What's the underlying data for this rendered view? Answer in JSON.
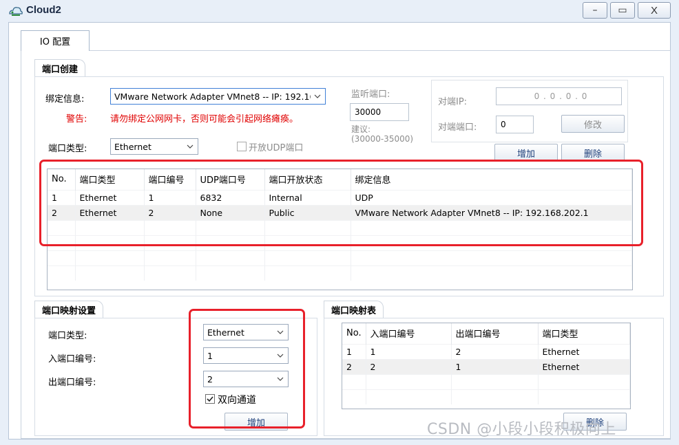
{
  "window": {
    "title": "Cloud2",
    "controls": {
      "minimize": "–",
      "maximize": "▭",
      "close": "X"
    }
  },
  "tabs": [
    {
      "label": "IO 配置",
      "active": true
    }
  ],
  "port_creation": {
    "group_title": "端口创建",
    "bind_info_label": "绑定信息:",
    "bind_info_value": "VMware Network Adapter VMnet8 -- IP: 192.16",
    "warning_label": "警告:",
    "warning_text": "请勿绑定公网网卡，否则可能会引起网络瘫痪。",
    "port_type_label": "端口类型:",
    "port_type_value": "Ethernet",
    "open_udp_label": "开放UDP端口",
    "open_udp_checked": false,
    "listen_port_label": "监听端口:",
    "listen_port_value": "30000",
    "suggest_label": "建议:",
    "suggest_range": "(30000-35000)",
    "peer_ip_label": "对端IP:",
    "peer_ip_value": "0 . 0 . 0 . 0",
    "peer_port_label": "对端端口:",
    "peer_port_value": "0",
    "modify_button": "修改",
    "add_button": "增加",
    "delete_button": "删除"
  },
  "port_table": {
    "columns": [
      "No.",
      "端口类型",
      "端口编号",
      "UDP端口号",
      "端口开放状态",
      "绑定信息"
    ],
    "rows": [
      [
        "1",
        "Ethernet",
        "1",
        "6832",
        "Internal",
        "UDP"
      ],
      [
        "2",
        "Ethernet",
        "2",
        "None",
        "Public",
        "VMware Network Adapter VMnet8 -- IP: 192.168.202.1"
      ]
    ]
  },
  "mapping_settings": {
    "group_title": "端口映射设置",
    "port_type_label": "端口类型:",
    "port_type_value": "Ethernet",
    "in_port_label": "入端口编号:",
    "in_port_value": "1",
    "out_port_label": "出端口编号:",
    "out_port_value": "2",
    "bidirectional_label": "双向通道",
    "bidirectional_checked": true,
    "add_button": "增加"
  },
  "mapping_table": {
    "group_title": "端口映射表",
    "columns": [
      "No.",
      "入端口编号",
      "出端口编号",
      "端口类型"
    ],
    "rows": [
      [
        "1",
        "1",
        "2",
        "Ethernet"
      ],
      [
        "2",
        "2",
        "1",
        "Ethernet"
      ]
    ],
    "delete_button": "删除"
  },
  "watermark": "CSDN @小段小段积极向上",
  "colors": {
    "warning": "#e00000",
    "annotation": "#e8202a",
    "button_text": "#1d3f7a"
  }
}
